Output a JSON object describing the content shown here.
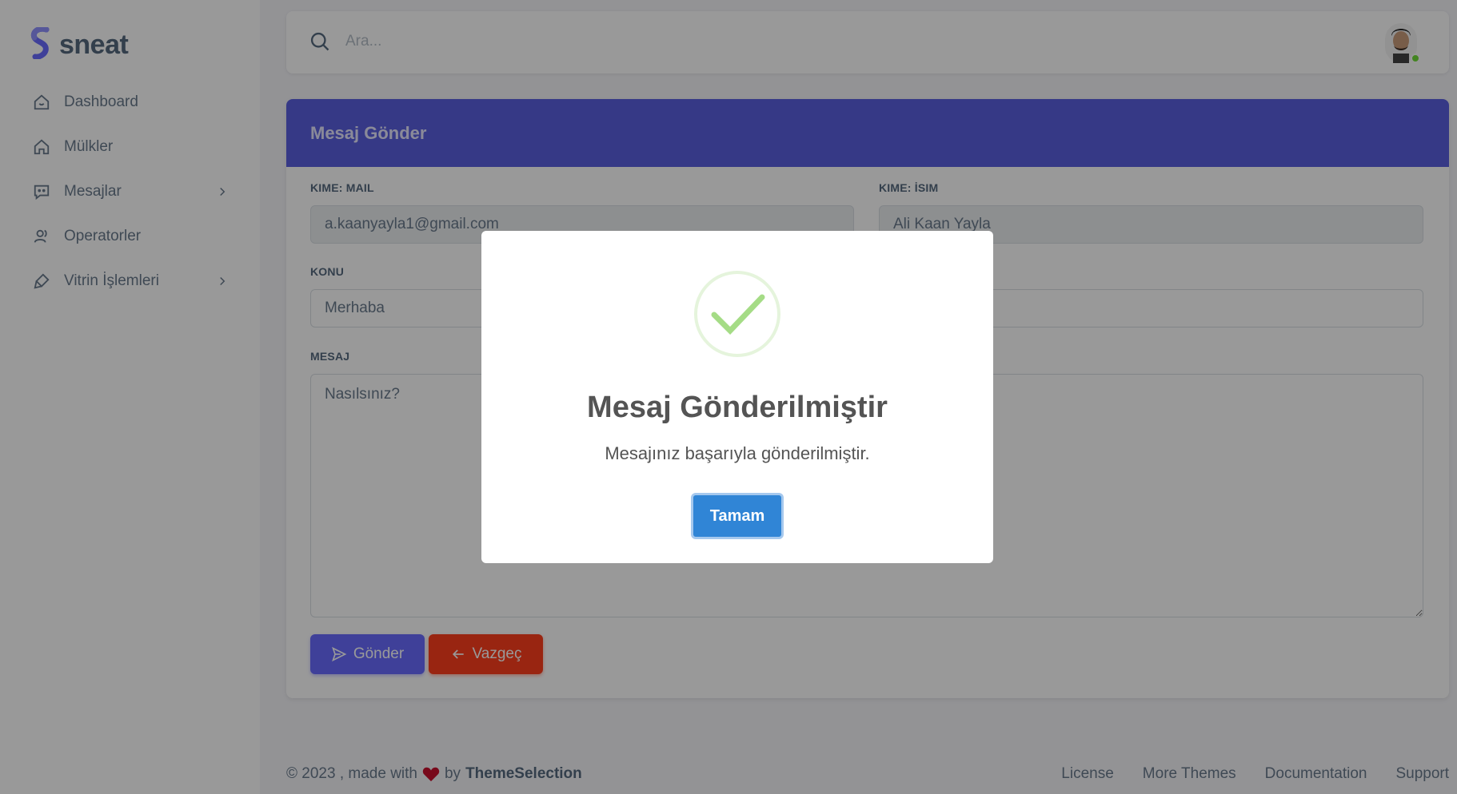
{
  "brand": {
    "name": "sneat",
    "color": "#696cff"
  },
  "sidebar": {
    "items": [
      {
        "label": "Dashboard",
        "icon": "home-smile-icon"
      },
      {
        "label": "Mülkler",
        "icon": "home-icon"
      },
      {
        "label": "Mesajlar",
        "icon": "message-icon",
        "has_children": true
      },
      {
        "label": "Operatorler",
        "icon": "user-icon"
      },
      {
        "label": "Vitrin İşlemleri",
        "icon": "brush-icon",
        "has_children": true
      }
    ]
  },
  "navbar": {
    "search_placeholder": "Ara..."
  },
  "form": {
    "title": "Mesaj Gönder",
    "to_mail_label": "KIME: MAIL",
    "to_mail_value": "a.kaanyayla1@gmail.com",
    "to_name_label": "KIME: İSIM",
    "to_name_value": "Ali Kaan Yayla",
    "subject_label": "KONU",
    "subject_value": "Merhaba",
    "message_label": "MESAJ",
    "message_value": "Nasılsınız?",
    "send_label": "Gönder",
    "cancel_label": "Vazgeç"
  },
  "footer": {
    "copyright": "© 2023 , made with",
    "by": "by",
    "author": "ThemeSelection",
    "links": [
      "License",
      "More Themes",
      "Documentation",
      "Support"
    ]
  },
  "modal": {
    "title": "Mesaj Gönderilmiştir",
    "text": "Mesajınız başarıyla gönderilmiştir.",
    "confirm_label": "Tamam",
    "status": "success"
  },
  "colors": {
    "primary": "#696cff",
    "danger": "#ff3e1d",
    "success": "#a5dc86",
    "modal_button": "#3085d6",
    "online": "#71dd37"
  }
}
